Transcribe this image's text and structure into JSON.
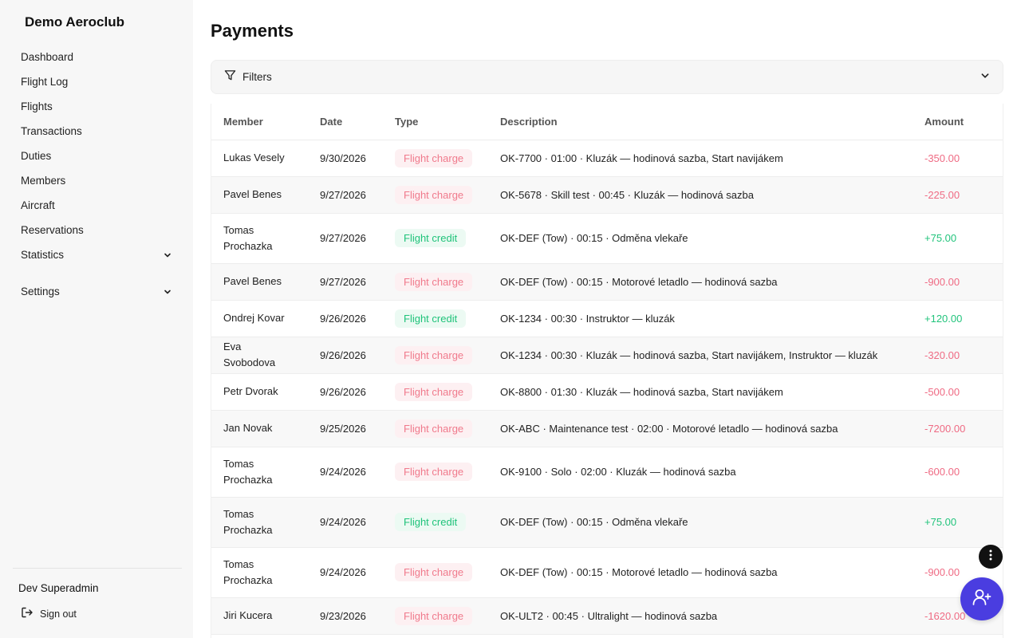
{
  "app": {
    "brand": "Demo Aeroclub"
  },
  "sidebar": {
    "items": [
      {
        "label": "Dashboard"
      },
      {
        "label": "Flight Log"
      },
      {
        "label": "Flights"
      },
      {
        "label": "Transactions"
      },
      {
        "label": "Duties"
      },
      {
        "label": "Members"
      },
      {
        "label": "Aircraft"
      },
      {
        "label": "Reservations"
      },
      {
        "label": "Statistics"
      },
      {
        "label": "Settings"
      }
    ],
    "user": "Dev Superadmin",
    "signout": "Sign out"
  },
  "main": {
    "title": "Payments",
    "filters_label": "Filters"
  },
  "table": {
    "headers": {
      "member": "Member",
      "date": "Date",
      "type": "Type",
      "description": "Description",
      "amount": "Amount"
    },
    "rows": [
      {
        "member": "Lukas Vesely",
        "date": "9/30/2026",
        "type": "Flight charge",
        "kind": "charge",
        "description": "OK-7700 · 01:00 · Kluzák — hodinová sazba, Start navijákem",
        "amount": "-350.00"
      },
      {
        "member": "Pavel Benes",
        "date": "9/27/2026",
        "type": "Flight charge",
        "kind": "charge",
        "description": "OK-5678 · Skill test · 00:45 · Kluzák — hodinová sazba",
        "amount": "-225.00"
      },
      {
        "member": "Tomas Prochazka",
        "date": "9/27/2026",
        "type": "Flight credit",
        "kind": "credit",
        "description": "OK-DEF (Tow) · 00:15 · Odměna vlekaře",
        "amount": "+75.00"
      },
      {
        "member": "Pavel Benes",
        "date": "9/27/2026",
        "type": "Flight charge",
        "kind": "charge",
        "description": "OK-DEF (Tow) · 00:15 · Motorové letadlo — hodinová sazba",
        "amount": "-900.00"
      },
      {
        "member": "Ondrej Kovar",
        "date": "9/26/2026",
        "type": "Flight credit",
        "kind": "credit",
        "description": "OK-1234 · 00:30 · Instruktor — kluzák",
        "amount": "+120.00"
      },
      {
        "member": "Eva Svobodova",
        "date": "9/26/2026",
        "type": "Flight charge",
        "kind": "charge",
        "description": "OK-1234 · 00:30 · Kluzák — hodinová sazba, Start navijákem, Instruktor — kluzák",
        "amount": "-320.00"
      },
      {
        "member": "Petr Dvorak",
        "date": "9/26/2026",
        "type": "Flight charge",
        "kind": "charge",
        "description": "OK-8800 · 01:30 · Kluzák — hodinová sazba, Start navijákem",
        "amount": "-500.00"
      },
      {
        "member": "Jan Novak",
        "date": "9/25/2026",
        "type": "Flight charge",
        "kind": "charge",
        "description": "OK-ABC · Maintenance test · 02:00 · Motorové letadlo — hodinová sazba",
        "amount": "-7200.00"
      },
      {
        "member": "Tomas Prochazka",
        "date": "9/24/2026",
        "type": "Flight charge",
        "kind": "charge",
        "description": "OK-9100 · Solo · 02:00 · Kluzák — hodinová sazba",
        "amount": "-600.00"
      },
      {
        "member": "Tomas Prochazka",
        "date": "9/24/2026",
        "type": "Flight credit",
        "kind": "credit",
        "description": "OK-DEF (Tow) · 00:15 · Odměna vlekaře",
        "amount": "+75.00"
      },
      {
        "member": "Tomas Prochazka",
        "date": "9/24/2026",
        "type": "Flight charge",
        "kind": "charge",
        "description": "OK-DEF (Tow) · 00:15 · Motorové letadlo — hodinová sazba",
        "amount": "-900.00"
      },
      {
        "member": "Jiri Kucera",
        "date": "9/23/2026",
        "type": "Flight charge",
        "kind": "charge",
        "description": "OK-ULT2 · 00:45 · Ultralight — hodinová sazba",
        "amount": "-1620.00"
      }
    ]
  },
  "colors": {
    "accent": "#4a3de0",
    "charge": "#ef6b84",
    "credit": "#22c47c"
  },
  "icons": {
    "filter": "filter-icon",
    "chevron": "chevron-down-icon",
    "signout": "sign-out-icon",
    "more": "more-vertical-icon",
    "add_user": "user-plus-icon"
  }
}
